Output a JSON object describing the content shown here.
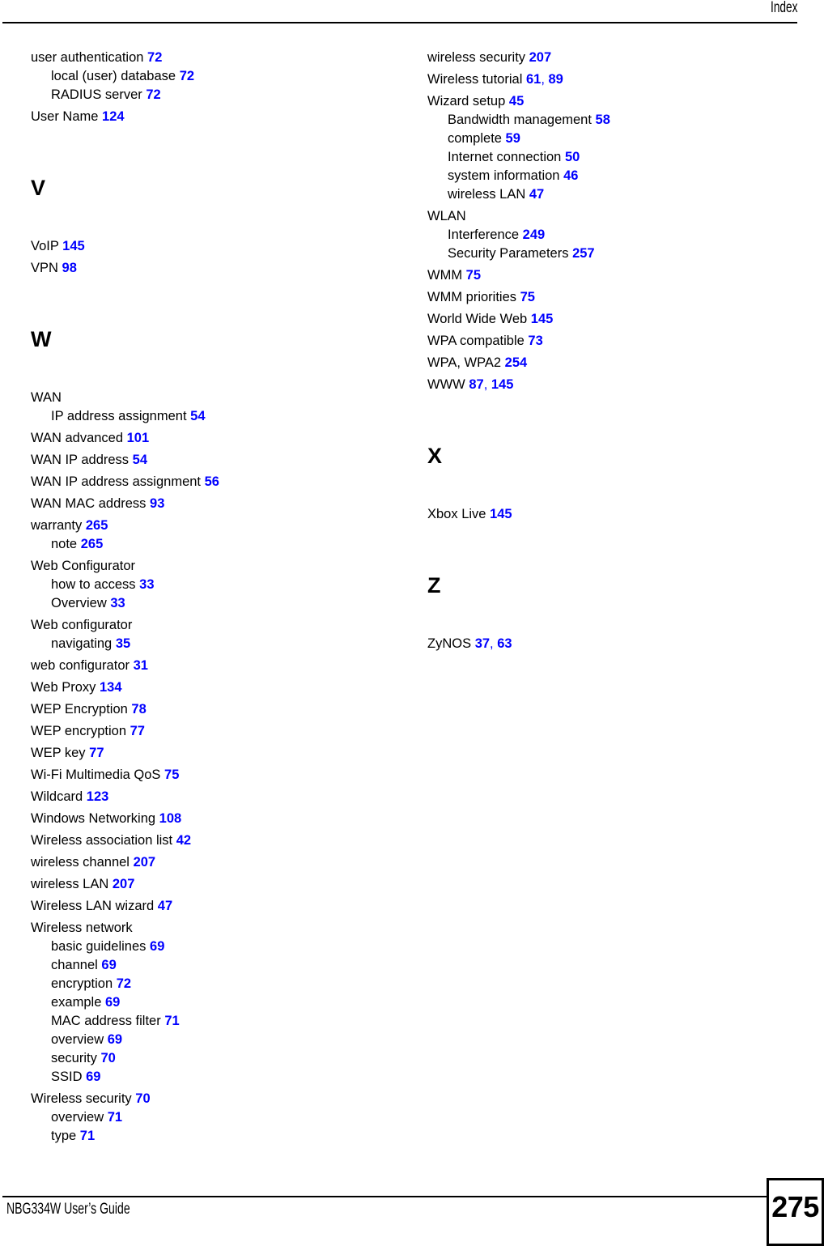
{
  "header": {
    "title": "Index"
  },
  "footer": {
    "guide_title": "NBG334W User’s Guide",
    "page_number": "275"
  },
  "colors": {
    "page_reference": "#0000FF",
    "text": "#000000",
    "background": "#FFFFFF"
  },
  "columns": [
    {
      "name": "left",
      "blocks": [
        {
          "type": "group",
          "entries": [
            {
              "level": 0,
              "label": "user authentication",
              "pages": "72"
            },
            {
              "level": 1,
              "label": "local (user) database",
              "pages": "72"
            },
            {
              "level": 1,
              "label": "RADIUS server",
              "pages": "72"
            }
          ]
        },
        {
          "type": "group",
          "entries": [
            {
              "level": 0,
              "label": "User Name",
              "pages": "124"
            }
          ]
        },
        {
          "type": "letter",
          "letter": "V"
        },
        {
          "type": "group",
          "entries": [
            {
              "level": 0,
              "label": "VoIP",
              "pages": "145"
            }
          ]
        },
        {
          "type": "group",
          "entries": [
            {
              "level": 0,
              "label": "VPN",
              "pages": "98"
            }
          ]
        },
        {
          "type": "letter",
          "letter": "W"
        },
        {
          "type": "group",
          "entries": [
            {
              "level": 0,
              "label": "WAN",
              "pages": ""
            },
            {
              "level": 1,
              "label": "IP address assignment",
              "pages": "54"
            }
          ]
        },
        {
          "type": "group",
          "entries": [
            {
              "level": 0,
              "label": "WAN advanced",
              "pages": "101"
            }
          ]
        },
        {
          "type": "group",
          "entries": [
            {
              "level": 0,
              "label": "WAN IP address",
              "pages": "54"
            }
          ]
        },
        {
          "type": "group",
          "entries": [
            {
              "level": 0,
              "label": "WAN IP address assignment",
              "pages": "56"
            }
          ]
        },
        {
          "type": "group",
          "entries": [
            {
              "level": 0,
              "label": "WAN MAC address",
              "pages": "93"
            }
          ]
        },
        {
          "type": "group",
          "entries": [
            {
              "level": 0,
              "label": "warranty",
              "pages": "265"
            },
            {
              "level": 1,
              "label": "note",
              "pages": "265"
            }
          ]
        },
        {
          "type": "group",
          "entries": [
            {
              "level": 0,
              "label": "Web Configurator",
              "pages": ""
            },
            {
              "level": 1,
              "label": "how to access",
              "pages": "33"
            },
            {
              "level": 1,
              "label": "Overview",
              "pages": "33"
            }
          ]
        },
        {
          "type": "group",
          "entries": [
            {
              "level": 0,
              "label": "Web configurator",
              "pages": ""
            },
            {
              "level": 1,
              "label": "navigating",
              "pages": "35"
            }
          ]
        },
        {
          "type": "group",
          "entries": [
            {
              "level": 0,
              "label": "web configurator",
              "pages": "31"
            }
          ]
        },
        {
          "type": "group",
          "entries": [
            {
              "level": 0,
              "label": "Web Proxy",
              "pages": "134"
            }
          ]
        },
        {
          "type": "group",
          "entries": [
            {
              "level": 0,
              "label": "WEP Encryption",
              "pages": "78"
            }
          ]
        },
        {
          "type": "group",
          "entries": [
            {
              "level": 0,
              "label": "WEP encryption",
              "pages": "77"
            }
          ]
        },
        {
          "type": "group",
          "entries": [
            {
              "level": 0,
              "label": "WEP key",
              "pages": "77"
            }
          ]
        },
        {
          "type": "group",
          "entries": [
            {
              "level": 0,
              "label": "Wi-Fi Multimedia QoS",
              "pages": "75"
            }
          ]
        },
        {
          "type": "group",
          "entries": [
            {
              "level": 0,
              "label": "Wildcard",
              "pages": "123"
            }
          ]
        },
        {
          "type": "group",
          "entries": [
            {
              "level": 0,
              "label": "Windows Networking",
              "pages": "108"
            }
          ]
        },
        {
          "type": "group",
          "entries": [
            {
              "level": 0,
              "label": "Wireless association list",
              "pages": "42"
            }
          ]
        },
        {
          "type": "group",
          "entries": [
            {
              "level": 0,
              "label": "wireless channel",
              "pages": "207"
            }
          ]
        },
        {
          "type": "group",
          "entries": [
            {
              "level": 0,
              "label": "wireless LAN",
              "pages": "207"
            }
          ]
        },
        {
          "type": "group",
          "entries": [
            {
              "level": 0,
              "label": "Wireless LAN wizard",
              "pages": "47"
            }
          ]
        },
        {
          "type": "group",
          "entries": [
            {
              "level": 0,
              "label": "Wireless network",
              "pages": ""
            },
            {
              "level": 1,
              "label": "basic guidelines",
              "pages": "69"
            },
            {
              "level": 1,
              "label": "channel",
              "pages": "69"
            },
            {
              "level": 1,
              "label": "encryption",
              "pages": "72"
            },
            {
              "level": 1,
              "label": "example",
              "pages": "69"
            },
            {
              "level": 1,
              "label": "MAC address filter",
              "pages": "71"
            },
            {
              "level": 1,
              "label": "overview",
              "pages": "69"
            },
            {
              "level": 1,
              "label": "security",
              "pages": "70"
            },
            {
              "level": 1,
              "label": "SSID",
              "pages": "69"
            }
          ]
        },
        {
          "type": "group",
          "entries": [
            {
              "level": 0,
              "label": "Wireless security",
              "pages": "70"
            },
            {
              "level": 1,
              "label": "overview",
              "pages": "71"
            },
            {
              "level": 1,
              "label": "type",
              "pages": "71"
            }
          ]
        }
      ]
    },
    {
      "name": "right",
      "blocks": [
        {
          "type": "group",
          "entries": [
            {
              "level": 0,
              "label": "wireless security",
              "pages": "207"
            }
          ]
        },
        {
          "type": "group",
          "entries": [
            {
              "level": 0,
              "label": "Wireless tutorial",
              "pages": "61, 89"
            }
          ]
        },
        {
          "type": "group",
          "entries": [
            {
              "level": 0,
              "label": "Wizard setup",
              "pages": "45"
            },
            {
              "level": 1,
              "label": "Bandwidth management",
              "pages": "58"
            },
            {
              "level": 1,
              "label": "complete",
              "pages": "59"
            },
            {
              "level": 1,
              "label": "Internet connection",
              "pages": "50"
            },
            {
              "level": 1,
              "label": "system information",
              "pages": "46"
            },
            {
              "level": 1,
              "label": "wireless LAN",
              "pages": "47"
            }
          ]
        },
        {
          "type": "group",
          "entries": [
            {
              "level": 0,
              "label": "WLAN",
              "pages": ""
            },
            {
              "level": 1,
              "label": "Interference",
              "pages": "249"
            },
            {
              "level": 1,
              "label": "Security Parameters",
              "pages": "257"
            }
          ]
        },
        {
          "type": "group",
          "entries": [
            {
              "level": 0,
              "label": "WMM",
              "pages": "75"
            }
          ]
        },
        {
          "type": "group",
          "entries": [
            {
              "level": 0,
              "label": "WMM priorities",
              "pages": "75"
            }
          ]
        },
        {
          "type": "group",
          "entries": [
            {
              "level": 0,
              "label": "World Wide Web",
              "pages": "145"
            }
          ]
        },
        {
          "type": "group",
          "entries": [
            {
              "level": 0,
              "label": "WPA compatible",
              "pages": "73"
            }
          ]
        },
        {
          "type": "group",
          "entries": [
            {
              "level": 0,
              "label": "WPA, WPA2",
              "pages": "254"
            }
          ]
        },
        {
          "type": "group",
          "entries": [
            {
              "level": 0,
              "label": "WWW",
              "pages": "87, 145"
            }
          ]
        },
        {
          "type": "letter",
          "letter": "X"
        },
        {
          "type": "group",
          "entries": [
            {
              "level": 0,
              "label": "Xbox Live",
              "pages": "145"
            }
          ]
        },
        {
          "type": "letter",
          "letter": "Z"
        },
        {
          "type": "group",
          "entries": [
            {
              "level": 0,
              "label": "ZyNOS",
              "pages": "37, 63"
            }
          ]
        }
      ]
    }
  ]
}
